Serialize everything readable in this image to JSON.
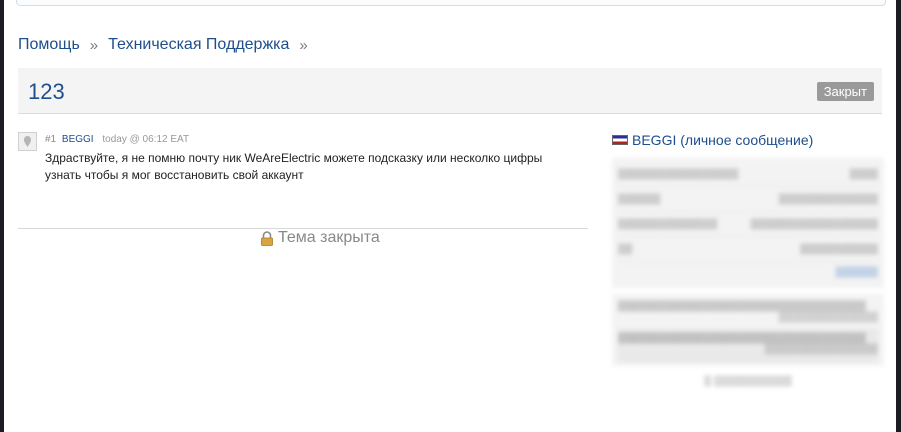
{
  "breadcrumb": {
    "items": [
      "Помощь",
      "Техническая Поддержка"
    ],
    "separator": "»"
  },
  "topic": {
    "title": "123",
    "status_badge": "Закрыт"
  },
  "post": {
    "number": "#1",
    "author": "BEGGI",
    "time": "today @ 06:12 EAT",
    "body": "Здраствуйте, я не помню почту ник WeAreElectric можете подсказку или несколко цифры узнать чтобы я мог восстановить свой аккаунт"
  },
  "closed_notice": {
    "text": "Тема закрыта",
    "icon": "lock-icon"
  },
  "sidebar": {
    "header": "BEGGI (личное сообщение)",
    "flag_icon": "flag-icon"
  },
  "colors": {
    "link": "#1e4e8c",
    "badge": "#9a9a9a"
  }
}
